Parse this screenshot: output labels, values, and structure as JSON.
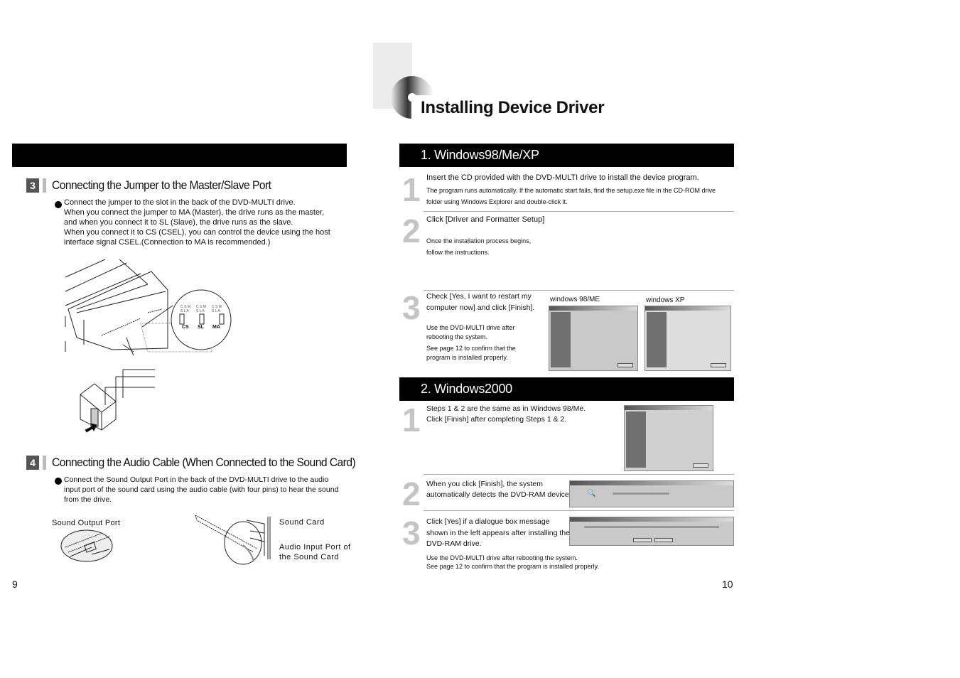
{
  "left_page": {
    "section3": {
      "badge": "3",
      "title": "Connecting the Jumper to the Master/Slave Port",
      "lines": [
        "Connect the jumper to the slot in the back of the DVD-MULTI drive.",
        "When you connect the jumper to MA (Master), the drive runs as the master,",
        "and when you connect it to SL (Slave), the drive runs as the slave.",
        "When you connect it to CS (CSEL), you can control the device using the host",
        "interface signal CSEL.(Connection to MA is recommended.)"
      ],
      "jumper_labels": [
        "CS",
        "SL",
        "MA"
      ]
    },
    "section4": {
      "badge": "4",
      "title": "Connecting the Audio Cable (When Connected to the Sound Card)",
      "lines": [
        "Connect the Sound Output Port in the back of the DVD-MULTI drive to the audio",
        "input port of the sound card using the audio cable (with four pins) to hear the sound",
        "from the drive."
      ],
      "label_sound_output": "Sound Output Port",
      "label_sound_card": "Sound Card",
      "label_audio_input_1": "Audio Input Port of",
      "label_audio_input_2": "the Sound Card"
    },
    "page_number": "9"
  },
  "right_page": {
    "title": "Installing Device Driver",
    "win98": {
      "header": "1. Windows98/Me/XP",
      "step1": {
        "num": "1",
        "main": "Insert the CD provided with the DVD-MULTI drive to install the device program.",
        "sub1": "The program runs automatically. If the automatic start fails, find the setup.exe file in the CD-ROM drive",
        "sub2": "folder using Windows Explorer and double-click it."
      },
      "step2": {
        "num": "2",
        "main": "Click [Driver and Formatter Setup]",
        "sub1": "Once the installation process begins,",
        "sub2": "follow the instructions."
      },
      "step3": {
        "num": "3",
        "main1": "Check [Yes, I want to restart my",
        "main2": "computer now] and click [Finish].",
        "sub1": "Use the DVD-MULTI drive after",
        "sub2": "rebooting the system.",
        "sub3": "See page 12 to confirm that the",
        "sub4": "program is installed properly.",
        "cap_98": "windows 98/ME",
        "cap_xp": "windows XP"
      }
    },
    "win2000": {
      "header": "2. Windows2000",
      "step1": {
        "num": "1",
        "line1": "Steps 1 & 2 are the same as in Windows 98/Me.",
        "line2": "Click [Finish] after completing Steps 1 & 2."
      },
      "step2": {
        "num": "2",
        "line1": "When you click [Finish], the system",
        "line2": "automatically detects the DVD-RAM device."
      },
      "step3": {
        "num": "3",
        "line1": "Click [Yes] if a dialogue box message",
        "line2": "shown in the left appears after installing the",
        "line3": "DVD-RAM drive."
      },
      "footer1": "Use the DVD-MULTI drive after rebooting the system.",
      "footer2": "See page 12 to confirm that the program is installed properly."
    },
    "page_number": "10"
  }
}
